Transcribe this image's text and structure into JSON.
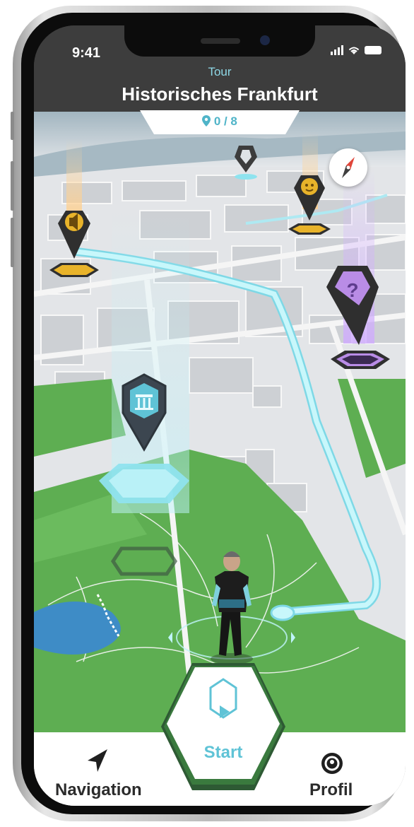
{
  "status_bar": {
    "time": "9:41"
  },
  "header": {
    "subtitle": "Tour",
    "title": "Historisches Frankfurt"
  },
  "progress": {
    "counter": "0 / 8",
    "visited": 0,
    "total": 8
  },
  "map": {
    "markers": [
      "music-marker",
      "knight-marker",
      "theater-marker",
      "mystery-marker",
      "museum-marker"
    ],
    "selected_marker": "museum-marker"
  },
  "bottom_nav": {
    "navigation_label": "Navigation",
    "start_label": "Start",
    "profile_label": "Profil"
  },
  "colors": {
    "accent": "#5fc3d6",
    "header_bg": "#3d3d3d",
    "route": "#a9eef5",
    "marker_gold": "#e8b32a",
    "marker_purple": "#b98ce6",
    "park_green": "#5eae52"
  },
  "icons": {
    "location": "location-pin-icon",
    "compass": "compass-icon",
    "navigation": "navigation-arrow-icon",
    "start": "play-icon",
    "profile": "profile-icon"
  }
}
